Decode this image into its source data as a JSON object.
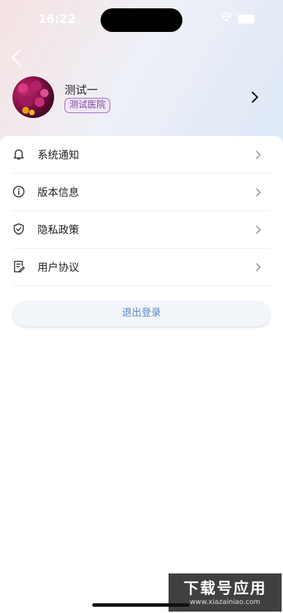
{
  "status_bar": {
    "time": "16:22"
  },
  "profile": {
    "name": "测试一",
    "hospital": "测试医院"
  },
  "menu": [
    {
      "label": "系统通知",
      "icon": "bell-icon"
    },
    {
      "label": "版本信息",
      "icon": "info-icon"
    },
    {
      "label": "隐私政策",
      "icon": "shield-icon"
    },
    {
      "label": "用户协议",
      "icon": "document-edit-icon"
    }
  ],
  "logout_label": "退出登录",
  "watermark": {
    "title": "下载号应用",
    "url": "www.xiazainiao.com"
  },
  "colors": {
    "accent": "#5a86c8",
    "badge_border": "#9a6bb4",
    "badge_text": "#7a4b98"
  }
}
